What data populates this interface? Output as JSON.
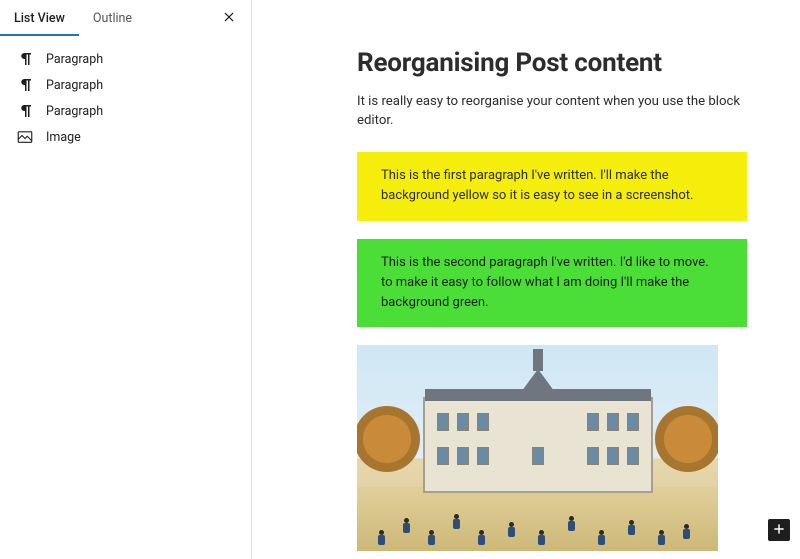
{
  "sidebar": {
    "tabs": {
      "list_view": "List View",
      "outline": "Outline"
    },
    "items": [
      {
        "label": "Paragraph",
        "icon": "paragraph-icon"
      },
      {
        "label": "Paragraph",
        "icon": "paragraph-icon"
      },
      {
        "label": "Paragraph",
        "icon": "paragraph-icon"
      },
      {
        "label": "Image",
        "icon": "image-icon"
      }
    ]
  },
  "document": {
    "title": "Reorganising Post content",
    "intro": "It is really easy to reorganise your content when you use the block editor.",
    "blocks": [
      {
        "type": "paragraph",
        "bg": "yellow",
        "text": "This is the first paragraph I've written. I'll make the background yellow so it is easy to see in a screenshot."
      },
      {
        "type": "paragraph",
        "bg": "green",
        "text": "This is the second paragraph I've written. I'd like to move. to make it easy to follow what I am doing I'll make the background green."
      },
      {
        "type": "image",
        "alt": "School building illustration"
      }
    ]
  },
  "icons": {
    "close": "close-icon",
    "add": "plus-icon"
  }
}
